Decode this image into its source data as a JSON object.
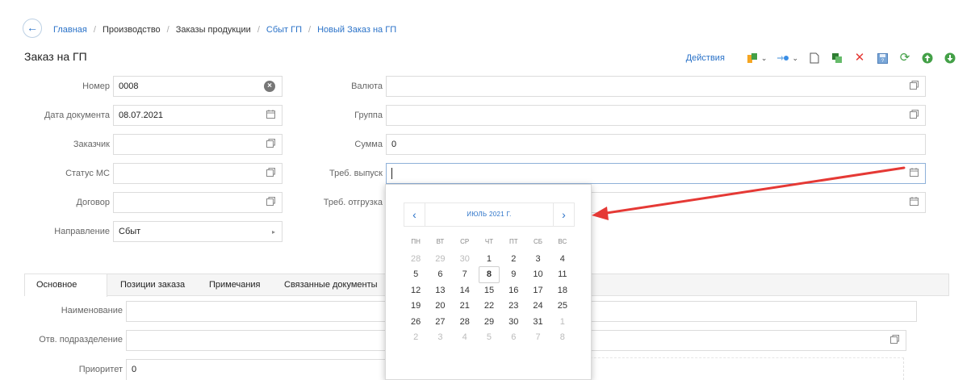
{
  "breadcrumb": {
    "back_icon": "arrow-left-icon",
    "items": [
      "Главная",
      "Производство",
      "Заказы продукции",
      "Сбыт ГП",
      "Новый Заказ на ГП"
    ],
    "separator": "/"
  },
  "page_title": "Заказ на ГП",
  "toolbar": {
    "actions_label": "Действия",
    "icons": [
      "document-move-icon",
      "arrow-dot-icon",
      "new-doc-icon",
      "copy-icon",
      "delete-icon",
      "save-icon",
      "refresh-icon",
      "up-icon",
      "down-icon"
    ]
  },
  "form": {
    "number_label": "Номер",
    "number_value": "0008",
    "doc_date_label": "Дата документа",
    "doc_date_value": "08.07.2021",
    "customer_label": "Заказчик",
    "customer_value": "",
    "ms_status_label": "Статус МС",
    "ms_status_value": "",
    "contract_label": "Договор",
    "contract_value": "",
    "direction_label": "Направление",
    "direction_value": "Сбыт",
    "currency_label": "Валюта",
    "currency_value": "",
    "group_label": "Группа",
    "group_value": "",
    "sum_label": "Сумма",
    "sum_value": "0",
    "req_release_label": "Треб. выпуск",
    "req_release_value": "",
    "req_shipment_label": "Треб. отгрузка",
    "req_shipment_value": ""
  },
  "tabs": [
    "Основное",
    "Позиции заказа",
    "Примечания",
    "Связанные документы"
  ],
  "detail": {
    "name_label": "Наименование",
    "name_value": "",
    "dept_label": "Отв. подразделение",
    "dept_value": "",
    "priority_label": "Приоритет",
    "priority_value": "0"
  },
  "datepicker": {
    "month_title": "ИЮЛЬ 2021 Г.",
    "prev": "‹",
    "next": "›",
    "weekdays": [
      "ПН",
      "ВТ",
      "СР",
      "ЧТ",
      "ПТ",
      "СБ",
      "ВС"
    ],
    "weeks": [
      [
        "28",
        "29",
        "30",
        "1",
        "2",
        "3",
        "4"
      ],
      [
        "5",
        "6",
        "7",
        "8",
        "9",
        "10",
        "11"
      ],
      [
        "12",
        "13",
        "14",
        "15",
        "16",
        "17",
        "18"
      ],
      [
        "19",
        "20",
        "21",
        "22",
        "23",
        "24",
        "25"
      ],
      [
        "26",
        "27",
        "28",
        "29",
        "30",
        "31",
        "1"
      ],
      [
        "2",
        "3",
        "4",
        "5",
        "6",
        "7",
        "8"
      ]
    ],
    "other_month": [
      [
        0,
        0
      ],
      [
        0,
        1
      ],
      [
        0,
        2
      ],
      [
        4,
        6
      ],
      [
        5,
        0
      ],
      [
        5,
        1
      ],
      [
        5,
        2
      ],
      [
        5,
        3
      ],
      [
        5,
        4
      ],
      [
        5,
        5
      ],
      [
        5,
        6
      ]
    ],
    "today": [
      1,
      3
    ]
  },
  "colors": {
    "link": "#2a72c8",
    "annotation_arrow": "#e53935"
  }
}
